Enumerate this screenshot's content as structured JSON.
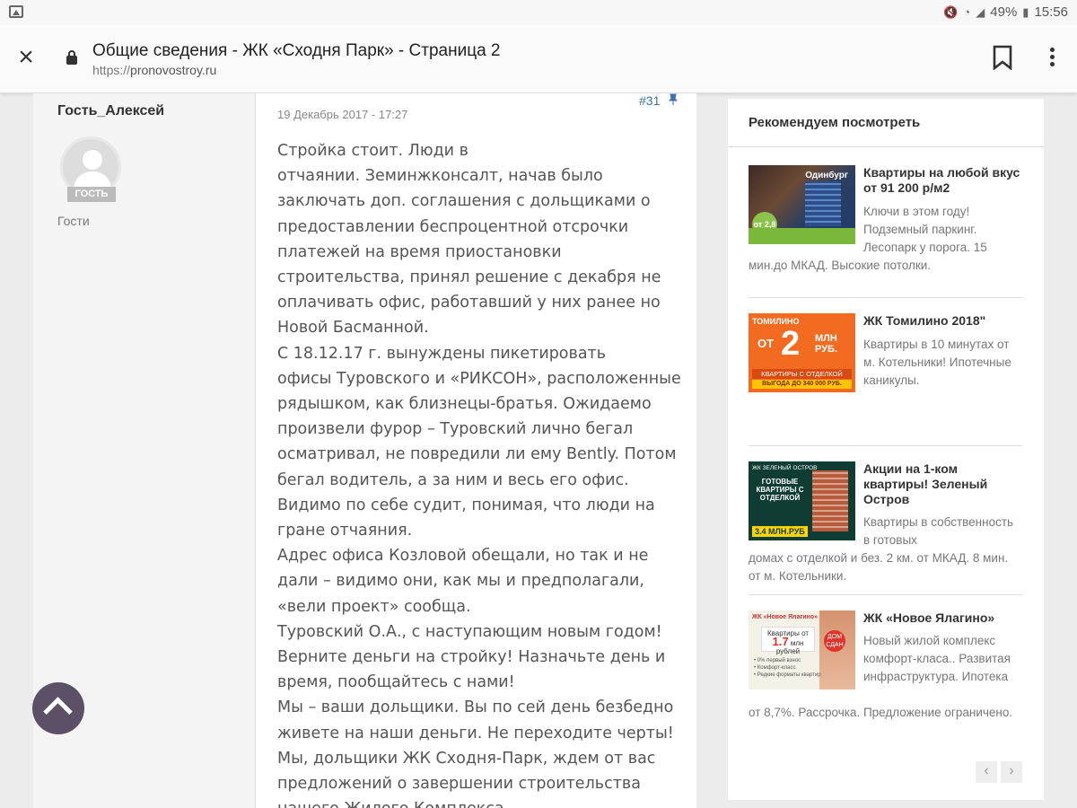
{
  "status_bar": {
    "battery": "49%",
    "time": "15:56"
  },
  "browser": {
    "title": "Общие сведения - ЖК «Сходня Парк» - Страница 2",
    "url_proto": "https://",
    "url_host": "pronovostroy.ru"
  },
  "post": {
    "author": "Гость_Алексей",
    "badge": "ГОСТЬ",
    "group": "Гости",
    "date": "19 Декабрь 2017 - 17:27",
    "number": "#31",
    "paragraphs": [
      "Стройка стоит. Люди в",
      "отчаянии. Земинжконсалт, начав было заключать доп. соглашения с дольщиками о предоставлении беспроцентной отсрочки платежей на время приостановки строительства, принял решение с декабря не оплачивать офис, работавший у них ранее но Новой Басманной.",
      "С 18.12.17 г. вынуждены пикетировать",
      "офисы Туровского и «РИКСОН», расположенные рядышком, как близнецы-братья. Ожидаемо произвели фурор – Туровский лично бегал осматривал, не повредили ли ему Bently. Потом бегал водитель, а за ним и весь его офис. Видимо по себе судит, понимая, что люди на гране отчаяния.",
      "Адрес офиса Козловой обещали, но так и не дали – видимо они, как мы и предполагали, «вели проект» сообща.",
      "Туровский О.А., с наступающим новым годом! Верните деньги на стройку! Назначьте день и время, пообщайтесь с нами!",
      "Мы – ваши дольщики. Вы по сей день безбедно живете на наши деньги. Не переходите черты!",
      "Мы, дольщики ЖК Сходня-Парк, ждем от вас предложений о завершении строительства нашего Жилого Комплекса."
    ]
  },
  "sidebar": {
    "title": "Рекомендуем посмотреть",
    "items": [
      {
        "title": "Квартиры на любой вкус от 91 200 р/м2",
        "desc_side": "Ключи в этом году! Подземный паркинг. Лесопарк у порога. 15",
        "desc_full": "мин.до МКАД. Высокие потолки.",
        "thumb": {
          "brand": "Одинбург",
          "badge": "от 2,8"
        }
      },
      {
        "title": "ЖК Томилино 2018\"",
        "desc_side": "Квартиры в 10 минутах от м. Котельники! Ипотечные каникулы.",
        "desc_full": "",
        "thumb": {
          "l1": "ТОМИЛИНО",
          "pre": "ОТ",
          "big": "2",
          "unit": "МЛН РУБ.",
          "band": "КВАРТИРЫ С ОТДЕЛКОЙ",
          "band2": "ВЫГОДА ДО 340 000 РУБ."
        }
      },
      {
        "title": "Акции на 1-ком квартиры! Зеленый Остров",
        "desc_side": "Квартиры в собственность в готовых",
        "desc_full": "домах с отделкой и без. 2 км. от МКАД. 8 мин. от м. Котельники.",
        "thumb": {
          "l1": "ЖК ЗЕЛЕНЫЙ ОСТРОВ",
          "l2": "ГОТОВЫЕ КВАРТИРЫ С ОТДЕЛКОЙ",
          "price": "3.4 МЛН.РУБ"
        }
      },
      {
        "title": "ЖК «Новое Ялагино»",
        "desc_side": "Новый жилой комплекс комфорт-класа.. Развитая инфраструктура. Ипотека",
        "desc_full": "от 8,7%. Рассрочка. Предложение ограничено.",
        "thumb": {
          "l1": "ЖК «Новое Ялагино»",
          "l2": "Квартиры от",
          "price": "1.7",
          "unit": "млн рублей",
          "circle": "ДОМ СДАН",
          "bullets": "• 0% первый взнос\n• Комфорт-класс\n• Редкие форматы квартир"
        }
      }
    ],
    "prev_label": "‹",
    "next_label": "›"
  },
  "icons": {
    "close": "close-icon",
    "lock": "lock-icon",
    "bookmark": "bookmark-icon",
    "menu": "more-vert-icon",
    "scroll_top": "chevron-up-icon"
  }
}
